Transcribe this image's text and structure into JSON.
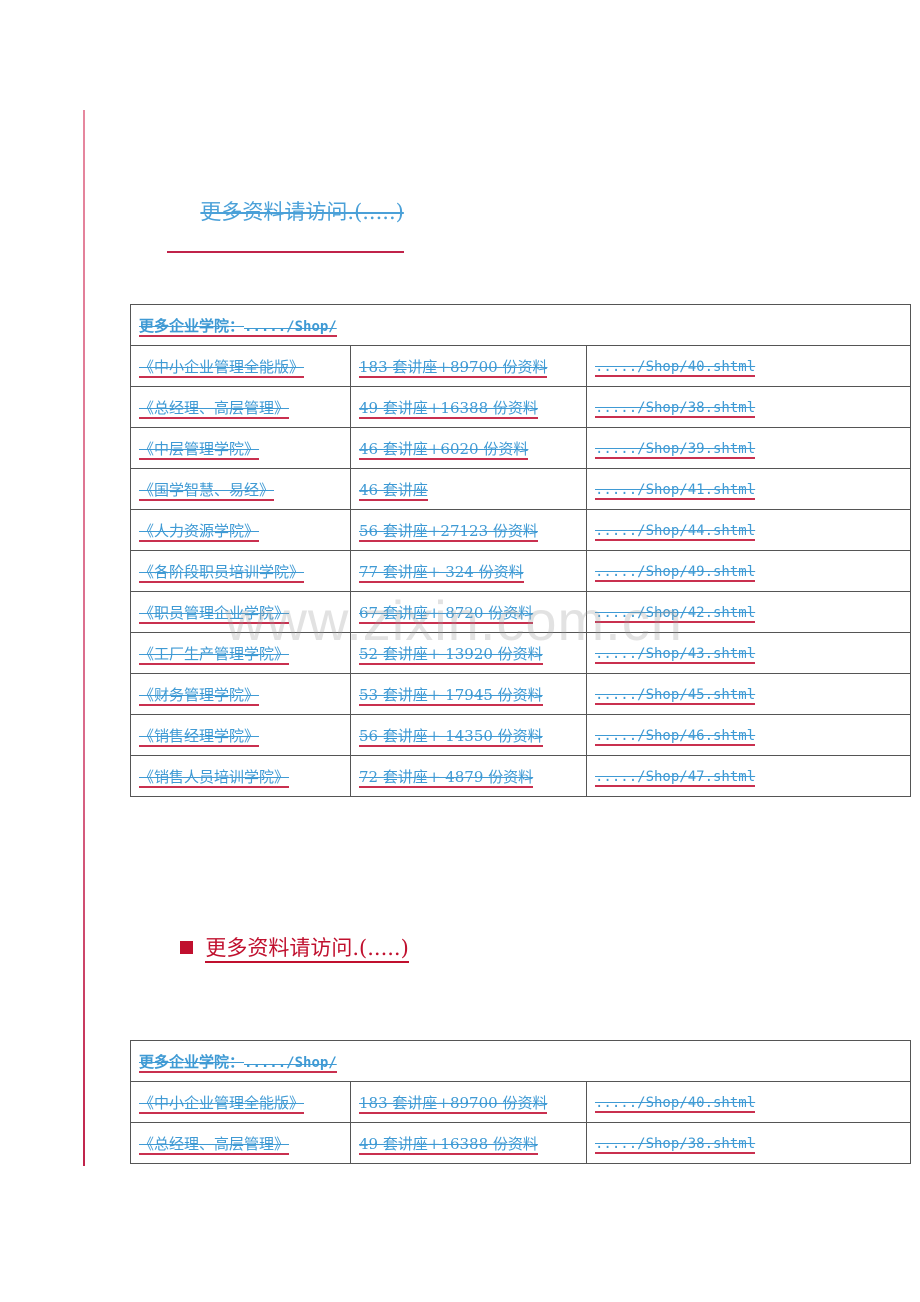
{
  "heading_top": {
    "prefix": "   ",
    "text": "更多资料请访问.(.....)"
  },
  "heading_bottom": {
    "bullet_icon": "square-bullet-icon",
    "text": "更多资料请访问.(.....)"
  },
  "watermark": "www.zixin.com.cn",
  "colors": {
    "link": "#3f9ad4",
    "underline": "#c9304f",
    "heading_red": "#c0102e",
    "margin_line": "#d9698a"
  },
  "table1": {
    "header": {
      "label": "更多企业学院：",
      "link": "...../Shop/"
    },
    "rows": [
      {
        "name": "《中小企业管理全能版》",
        "count": "183 套讲座+89700 份资料",
        "url": "...../Shop/40.shtml"
      },
      {
        "name": "《总经理、高层管理》",
        "count": "49 套讲座+16388 份资料",
        "url": "...../Shop/38.shtml"
      },
      {
        "name": "《中层管理学院》",
        "count": "46 套讲座+6020 份资料",
        "url": "...../Shop/39.shtml"
      },
      {
        "name": "《国学智慧、易经》",
        "count": "46 套讲座",
        "url": "...../Shop/41.shtml"
      },
      {
        "name": "《人力资源学院》",
        "count": "56 套讲座+27123 份资料",
        "url": "...../Shop/44.shtml"
      },
      {
        "name": "《各阶段职员培训学院》",
        "count": "77 套讲座+ 324 份资料",
        "url": "...../Shop/49.shtml"
      },
      {
        "name": "《职员管理企业学院》",
        "count": "67 套讲座+ 8720 份资料",
        "url": "...../Shop/42.shtml"
      },
      {
        "name": "《工厂生产管理学院》",
        "count": "52 套讲座+ 13920 份资料",
        "url": "...../Shop/43.shtml"
      },
      {
        "name": "《财务管理学院》",
        "count": "53 套讲座+ 17945 份资料",
        "url": "...../Shop/45.shtml"
      },
      {
        "name": "《销售经理学院》",
        "count": "56 套讲座+ 14350 份资料",
        "url": "...../Shop/46.shtml"
      },
      {
        "name": "《销售人员培训学院》",
        "count": "72 套讲座+ 4879 份资料",
        "url": "...../Shop/47.shtml"
      }
    ]
  },
  "table2": {
    "header": {
      "label": "更多企业学院：",
      "link": "...../Shop/"
    },
    "rows": [
      {
        "name": "《中小企业管理全能版》",
        "count": "183 套讲座+89700 份资料",
        "url": "...../Shop/40.shtml"
      },
      {
        "name": "《总经理、高层管理》",
        "count": "49 套讲座+16388 份资料",
        "url": "...../Shop/38.shtml"
      }
    ]
  }
}
